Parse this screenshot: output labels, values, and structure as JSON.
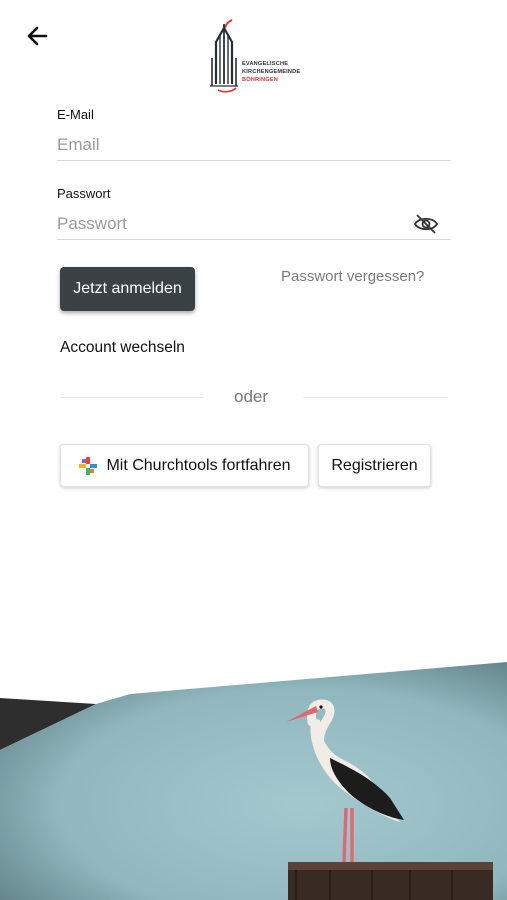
{
  "logo": {
    "line1": "EVANGELISCHE",
    "line2": "KIRCHENGEMEINDE",
    "line3": "BÖHRINGEN"
  },
  "form": {
    "email_label": "E-Mail",
    "email_placeholder": "Email",
    "email_value": "",
    "password_label": "Passwort",
    "password_placeholder": "Passwort",
    "password_value": ""
  },
  "actions": {
    "login_label": "Jetzt anmelden",
    "forgot_label": "Passwort vergessen?",
    "switch_account_label": "Account wechseln",
    "or_label": "oder",
    "churchtools_label": "Mit Churchtools fortfahren",
    "register_label": "Registrieren"
  },
  "icons": {
    "back": "arrow-left-icon",
    "password_visibility": "eye-off-icon",
    "churchtools": "churchtools-cross-icon"
  },
  "colors": {
    "primary_button": "#3b4246",
    "logo_accent": "#d9362b",
    "sky": "#94bdc4"
  }
}
